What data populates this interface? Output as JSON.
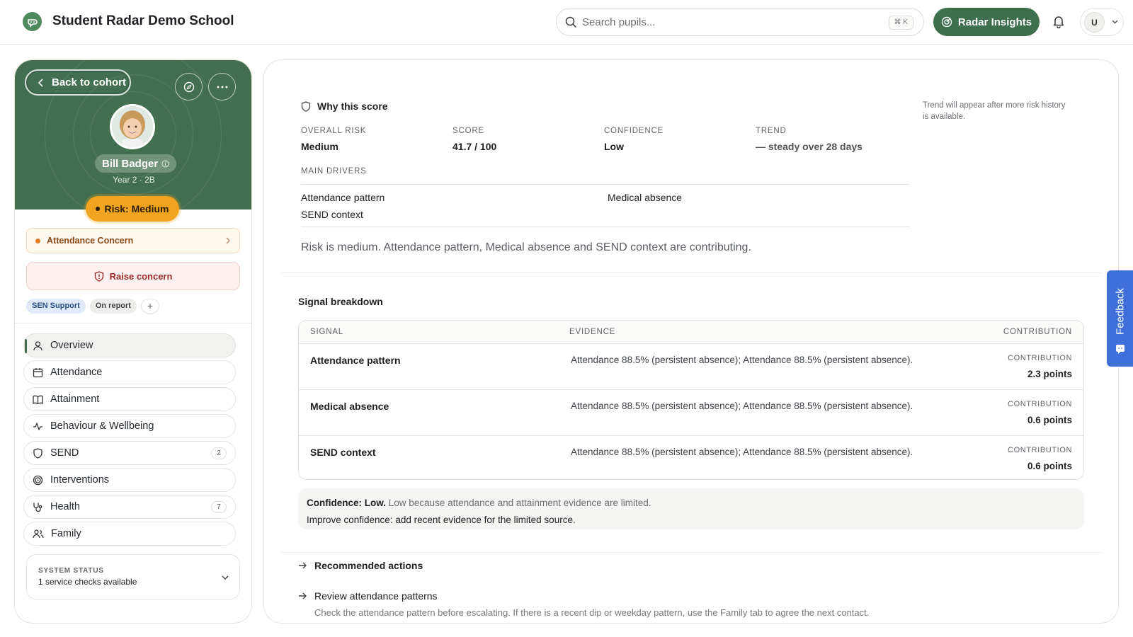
{
  "header": {
    "school_name": "Student Radar Demo School",
    "search_placeholder": "Search pupils...",
    "search_shortcut": "⌘ K",
    "insights_label": "Radar Insights",
    "user_initial": "U"
  },
  "pupil": {
    "back_label": "Back to cohort",
    "name": "Bill Badger",
    "year_group": "Year 2 · 2B",
    "risk_label": "Risk: Medium",
    "concern_label": "Attendance Concern",
    "raise_concern_label": "Raise concern",
    "tags": [
      "SEN Support",
      "On report"
    ],
    "add_tag_label": "+"
  },
  "nav": {
    "items": [
      {
        "label": "Overview",
        "icon": "user-icon",
        "badge": ""
      },
      {
        "label": "Attendance",
        "icon": "calendar-icon",
        "badge": ""
      },
      {
        "label": "Attainment",
        "icon": "book-icon",
        "badge": ""
      },
      {
        "label": "Behaviour & Wellbeing",
        "icon": "pulse-icon",
        "badge": ""
      },
      {
        "label": "SEND",
        "icon": "shield-icon",
        "badge": "2"
      },
      {
        "label": "Interventions",
        "icon": "target-icon",
        "badge": ""
      },
      {
        "label": "Health",
        "icon": "stethoscope-icon",
        "badge": "7"
      },
      {
        "label": "Family",
        "icon": "family-icon",
        "badge": ""
      }
    ]
  },
  "system_status": {
    "label": "SYSTEM STATUS",
    "value": "1 service checks available"
  },
  "score": {
    "title": "Why this score",
    "trend_note": "Trend will appear after more risk history is available.",
    "metrics": [
      {
        "label": "OVERALL RISK",
        "value": "Medium"
      },
      {
        "label": "SCORE",
        "value": "41.7 / 100"
      },
      {
        "label": "CONFIDENCE",
        "value": "Low"
      },
      {
        "label": "TREND",
        "value": "— steady over 28 days"
      }
    ],
    "drivers_label": "MAIN DRIVERS",
    "drivers": [
      "Attendance pattern",
      "Medical absence",
      "SEND context"
    ],
    "summary": "Risk is medium. Attendance pattern, Medical absence and SEND context are contributing."
  },
  "signals": {
    "title": "Signal breakdown",
    "columns": [
      "SIGNAL",
      "EVIDENCE",
      "CONTRIBUTION"
    ],
    "rows": [
      {
        "signal": "Attendance pattern",
        "evidence": "Attendance 88.5% (persistent absence); Attendance 88.5% (persistent absence).",
        "contribution_label": "CONTRIBUTION",
        "contribution": "2.3 points"
      },
      {
        "signal": "Medical absence",
        "evidence": "Attendance 88.5% (persistent absence); Attendance 88.5% (persistent absence).",
        "contribution_label": "CONTRIBUTION",
        "contribution": "0.6 points"
      },
      {
        "signal": "SEND context",
        "evidence": "Attendance 88.5% (persistent absence); Attendance 88.5% (persistent absence).",
        "contribution_label": "CONTRIBUTION",
        "contribution": "0.6 points"
      }
    ]
  },
  "confidence": {
    "lead": "Confidence: Low.",
    "reason": "Low because attendance and attainment evidence are limited.",
    "improve": "Improve confidence: add recent evidence for the limited source."
  },
  "actions": {
    "title": "Recommended actions",
    "items": [
      {
        "label": "Review attendance patterns",
        "description": "Check the attendance pattern before escalating. If there is a recent dip or weekday pattern, use the Family tab to agree the next contact."
      }
    ]
  },
  "feedback": {
    "label": "Feedback"
  },
  "colors": {
    "brand_green": "#3e6f4c",
    "risk_amber": "#f0a41f",
    "feedback_blue": "#3f6fd8"
  }
}
